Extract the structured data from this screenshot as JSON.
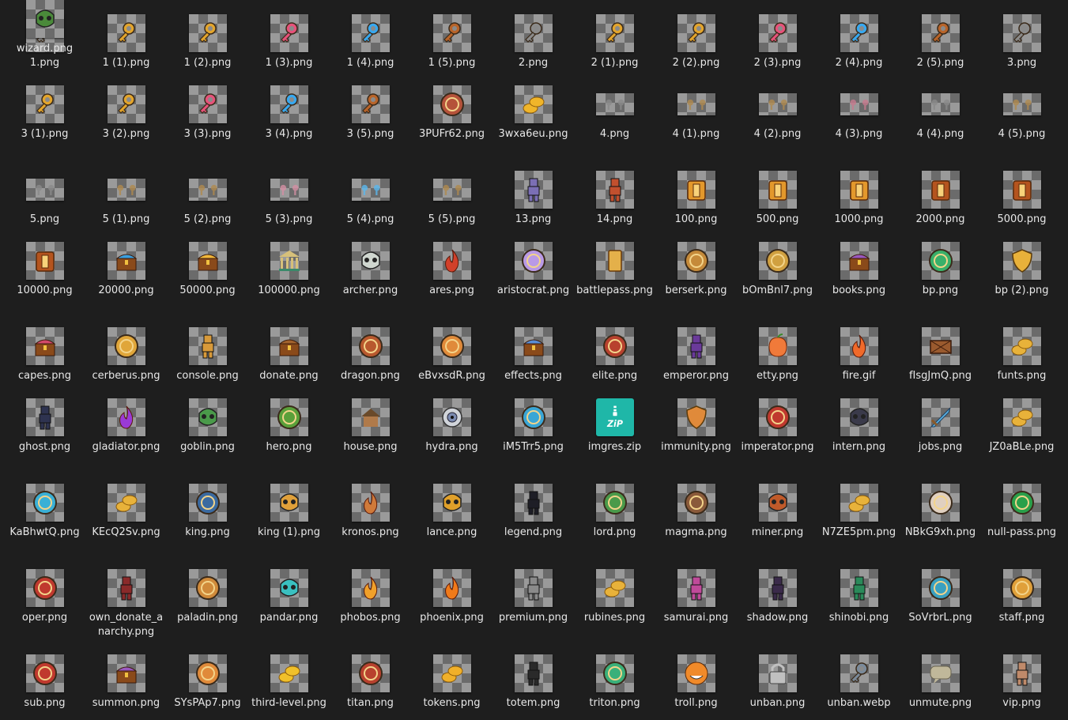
{
  "files": [
    {
      "name": "1.png",
      "icon": "key-gray-icon",
      "color": "#8b8b8b"
    },
    {
      "name": "1 (1).png",
      "icon": "key-gold-icon",
      "color": "#e3a52c"
    },
    {
      "name": "1 (2).png",
      "icon": "key-gold-icon",
      "color": "#e3a52c"
    },
    {
      "name": "1 (3).png",
      "icon": "key-pink-icon",
      "color": "#e6527a"
    },
    {
      "name": "1 (4).png",
      "icon": "key-blue-icon",
      "color": "#38a8ef"
    },
    {
      "name": "1 (5).png",
      "icon": "key-bronze-icon",
      "color": "#b8642a"
    },
    {
      "name": "2.png",
      "icon": "key-gray-icon",
      "color": "#8b8b8b"
    },
    {
      "name": "2 (1).png",
      "icon": "key-gold-icon",
      "color": "#e3a52c"
    },
    {
      "name": "2 (2).png",
      "icon": "key-gold-icon",
      "color": "#e3a52c"
    },
    {
      "name": "2 (3).png",
      "icon": "key-pink-icon",
      "color": "#e6527a"
    },
    {
      "name": "2 (4).png",
      "icon": "key-blue-icon",
      "color": "#38a8ef"
    },
    {
      "name": "2 (5).png",
      "icon": "key-bronze-icon",
      "color": "#b8642a"
    },
    {
      "name": "3.png",
      "icon": "key-gray-icon",
      "color": "#8b8b8b"
    },
    {
      "name": "3 (1).png",
      "icon": "key-gold-icon",
      "color": "#e3a52c"
    },
    {
      "name": "3 (2).png",
      "icon": "key-gold-icon",
      "color": "#e3a52c"
    },
    {
      "name": "3 (3).png",
      "icon": "key-pink-icon",
      "color": "#e6527a"
    },
    {
      "name": "3 (4).png",
      "icon": "key-blue-icon",
      "color": "#38a8ef"
    },
    {
      "name": "3 (5).png",
      "icon": "key-bronze-icon",
      "color": "#b8642a"
    },
    {
      "name": "3PUFr62.png",
      "icon": "avatar-image-icon",
      "color": "#b5523a"
    },
    {
      "name": "3wxa6eu.png",
      "icon": "gold-coins-icon",
      "color": "#f0b52a"
    },
    {
      "name": "4.png",
      "icon": "key-gray-icon",
      "color": "#8b8b8b",
      "wide": true
    },
    {
      "name": "4 (1).png",
      "icon": "key-gold-icon",
      "color": "#b08a4e",
      "wide": true
    },
    {
      "name": "4 (2).png",
      "icon": "key-gold-icon",
      "color": "#b08a4e",
      "wide": true
    },
    {
      "name": "4 (3).png",
      "icon": "key-pink-icon",
      "color": "#c77a8e",
      "wide": true
    },
    {
      "name": "4 (4).png",
      "icon": "key-blue-icon",
      "color": "#8b8b8b",
      "wide": true
    },
    {
      "name": "4 (5).png",
      "icon": "key-bronze-icon",
      "color": "#b08a4e",
      "wide": true
    },
    {
      "name": "5.png",
      "icon": "key-gray-icon",
      "color": "#8b8b8b",
      "wide": true
    },
    {
      "name": "5 (1).png",
      "icon": "key-gold-icon",
      "color": "#b08a4e",
      "wide": true
    },
    {
      "name": "5 (2).png",
      "icon": "key-gold-icon",
      "color": "#b08a4e",
      "wide": true
    },
    {
      "name": "5 (3).png",
      "icon": "key-pink-icon",
      "color": "#d590a4",
      "wide": true
    },
    {
      "name": "5 (4).png",
      "icon": "key-blue-icon",
      "color": "#5ab8ef",
      "wide": true
    },
    {
      "name": "5 (5).png",
      "icon": "key-bronze-icon",
      "color": "#b08a4e",
      "wide": true
    },
    {
      "name": "13.png",
      "icon": "character-image-icon",
      "color": "#7b6fb5"
    },
    {
      "name": "14.png",
      "icon": "character-image-icon",
      "color": "#c2502e"
    },
    {
      "name": "100.png",
      "icon": "case-icon",
      "color": "#e3982c"
    },
    {
      "name": "500.png",
      "icon": "case-icon",
      "color": "#e3982c"
    },
    {
      "name": "1000.png",
      "icon": "case-icon",
      "color": "#e3982c"
    },
    {
      "name": "2000.png",
      "icon": "case-icon",
      "color": "#b5541e"
    },
    {
      "name": "5000.png",
      "icon": "case-icon",
      "color": "#b5541e"
    },
    {
      "name": "10000.png",
      "icon": "case-icon",
      "color": "#b5541e"
    },
    {
      "name": "20000.png",
      "icon": "treasure-chest-icon",
      "color": "#3aa0e0"
    },
    {
      "name": "50000.png",
      "icon": "treasure-chest-icon",
      "color": "#f2b83a"
    },
    {
      "name": "100000.png",
      "icon": "temple-icon",
      "color": "#d6c07a"
    },
    {
      "name": "archer.png",
      "icon": "skull-icon",
      "color": "#cfd6cf"
    },
    {
      "name": "ares.png",
      "icon": "flame-emblem-icon",
      "color": "#d2402a"
    },
    {
      "name": "aristocrat.png",
      "icon": "winged-emblem-icon",
      "color": "#b99ae6"
    },
    {
      "name": "battlepass.png",
      "icon": "scroll-icon",
      "color": "#e4b04a"
    },
    {
      "name": "berserk.png",
      "icon": "avatar-badge-icon",
      "color": "#c58a3a"
    },
    {
      "name": "bOmBnl7.png",
      "icon": "avatar-badge-icon",
      "color": "#d0a040"
    },
    {
      "name": "books.png",
      "icon": "treasure-chest-icon",
      "color": "#9a58c0"
    },
    {
      "name": "bp.png",
      "icon": "battlepass-badge-icon",
      "color": "#39b06a"
    },
    {
      "name": "bp (2).png",
      "icon": "shield-icon",
      "color": "#e8b13a"
    },
    {
      "name": "capes.png",
      "icon": "treasure-chest-icon",
      "color": "#d24a6a"
    },
    {
      "name": "cerberus.png",
      "icon": "gold-emblem-icon",
      "color": "#e0a63a"
    },
    {
      "name": "console.png",
      "icon": "character-image-icon",
      "color": "#d89a3a"
    },
    {
      "name": "donate.png",
      "icon": "treasure-chest-icon",
      "color": "#a2632e"
    },
    {
      "name": "dragon.png",
      "icon": "avatar-badge-icon",
      "color": "#b8582e"
    },
    {
      "name": "eBvxsdR.png",
      "icon": "fox-emblem-icon",
      "color": "#e08a3a"
    },
    {
      "name": "effects.png",
      "icon": "treasure-chest-icon",
      "color": "#5a8ed6"
    },
    {
      "name": "elite.png",
      "icon": "avatar-badge-icon",
      "color": "#b8412e"
    },
    {
      "name": "emperor.png",
      "icon": "character-image-icon",
      "color": "#6a3a9a"
    },
    {
      "name": "etty.png",
      "icon": "fruit-icon",
      "color": "#f07a3a"
    },
    {
      "name": "fire.gif",
      "icon": "fire-icon",
      "color": "#f06a2a"
    },
    {
      "name": "fIsgJmQ.png",
      "icon": "crate-icon",
      "color": "#9a5a2e"
    },
    {
      "name": "funts.png",
      "icon": "gold-coins-icon",
      "color": "#e8b23a"
    },
    {
      "name": "ghost.png",
      "icon": "character-image-icon",
      "color": "#2e3350"
    },
    {
      "name": "gladiator.png",
      "icon": "purple-flame-icon",
      "color": "#9a3ad6"
    },
    {
      "name": "goblin.png",
      "icon": "goblin-mask-icon",
      "color": "#4a9a4a"
    },
    {
      "name": "hero.png",
      "icon": "avatar-badge-icon",
      "color": "#5aa03a"
    },
    {
      "name": "house.png",
      "icon": "house-icon",
      "color": "#b07a4a"
    },
    {
      "name": "hydra.png",
      "icon": "eye-orb-icon",
      "color": "#7a8ab0"
    },
    {
      "name": "iM5Trr5.png",
      "icon": "winged-emblem-icon",
      "color": "#3aa6d6"
    },
    {
      "name": "imgres.zip",
      "icon": "zip-archive-icon",
      "color": "#1fb7a8",
      "zip": true
    },
    {
      "name": "immunity.png",
      "icon": "shield-icon",
      "color": "#e08a3a"
    },
    {
      "name": "imperator.png",
      "icon": "avatar-badge-icon",
      "color": "#c0392e"
    },
    {
      "name": "intern.png",
      "icon": "dark-mask-icon",
      "color": "#3a3a4a"
    },
    {
      "name": "jobs.png",
      "icon": "sword-icon",
      "color": "#5ab0e0"
    },
    {
      "name": "JZ0aBLe.png",
      "icon": "gold-coins-icon",
      "color": "#e8b23a"
    },
    {
      "name": "KaBhwtQ.png",
      "icon": "winged-emblem-icon",
      "color": "#3ab0d6"
    },
    {
      "name": "KEcQ2Sv.png",
      "icon": "gold-coins-icon",
      "color": "#e8b23a"
    },
    {
      "name": "king.png",
      "icon": "avatar-badge-icon",
      "color": "#3a6aa0"
    },
    {
      "name": "king (1).png",
      "icon": "skull-crown-icon",
      "color": "#e0a03a"
    },
    {
      "name": "kronos.png",
      "icon": "flame-emblem-icon",
      "color": "#d07a3a"
    },
    {
      "name": "lance.png",
      "icon": "mask-icon",
      "color": "#e0a02a"
    },
    {
      "name": "legend.png",
      "icon": "character-image-icon",
      "color": "#1e1e26"
    },
    {
      "name": "lord.png",
      "icon": "avatar-badge-icon",
      "color": "#4a9a4a"
    },
    {
      "name": "magma.png",
      "icon": "avatar-badge-icon",
      "color": "#8a5a3a"
    },
    {
      "name": "miner.png",
      "icon": "mask-icon",
      "color": "#c05a2a"
    },
    {
      "name": "N7ZE5pm.png",
      "icon": "gold-coins-icon",
      "color": "#e8b23a"
    },
    {
      "name": "NBkG9xh.png",
      "icon": "winged-emblem-icon",
      "color": "#e0d0c0"
    },
    {
      "name": "null-pass.png",
      "icon": "badge-icon",
      "color": "#2aa04a"
    },
    {
      "name": "oper.png",
      "icon": "avatar-badge-icon",
      "color": "#c0392e"
    },
    {
      "name": "own_donate_anarchy.png",
      "icon": "character-image-icon",
      "color": "#8a2a2a"
    },
    {
      "name": "paladin.png",
      "icon": "avatar-badge-icon",
      "color": "#d08a3a"
    },
    {
      "name": "pandar.png",
      "icon": "skull-icon",
      "color": "#3ac0c0"
    },
    {
      "name": "phobos.png",
      "icon": "flame-emblem-icon",
      "color": "#f0a02a"
    },
    {
      "name": "phoenix.png",
      "icon": "flame-emblem-icon",
      "color": "#f07a1a"
    },
    {
      "name": "premium.png",
      "icon": "character-image-icon",
      "color": "#8a8a8a"
    },
    {
      "name": "rubines.png",
      "icon": "gold-coins-icon",
      "color": "#e8b23a"
    },
    {
      "name": "samurai.png",
      "icon": "character-image-icon",
      "color": "#c04a9a"
    },
    {
      "name": "shadow.png",
      "icon": "character-image-icon",
      "color": "#3a2a4a"
    },
    {
      "name": "shinobi.png",
      "icon": "character-image-icon",
      "color": "#2a8a5a"
    },
    {
      "name": "SoVrbrL.png",
      "icon": "winged-emblem-icon",
      "color": "#3aa0c0"
    },
    {
      "name": "staff.png",
      "icon": "gold-emblem-icon",
      "color": "#e0a03a"
    },
    {
      "name": "sub.png",
      "icon": "winged-emblem-icon",
      "color": "#c0392e"
    },
    {
      "name": "summon.png",
      "icon": "treasure-chest-icon",
      "color": "#9a58c0"
    },
    {
      "name": "SYsPAp7.png",
      "icon": "fox-emblem-icon",
      "color": "#e08a3a"
    },
    {
      "name": "third-level.png",
      "icon": "gold-coin-icon",
      "color": "#f0c02a"
    },
    {
      "name": "titan.png",
      "icon": "avatar-badge-icon",
      "color": "#b8412e"
    },
    {
      "name": "tokens.png",
      "icon": "gold-coins-icon",
      "color": "#f0b02a"
    },
    {
      "name": "totem.png",
      "icon": "character-image-icon",
      "color": "#2a2a2a"
    },
    {
      "name": "triton.png",
      "icon": "winged-emblem-icon",
      "color": "#3ab07a"
    },
    {
      "name": "troll.png",
      "icon": "troll-face-icon",
      "color": "#f08a2a"
    },
    {
      "name": "unban.png",
      "icon": "padlock-icon",
      "color": "#c0c0c0"
    },
    {
      "name": "unban.webp",
      "icon": "key-card-icon",
      "color": "#7a8a9a"
    },
    {
      "name": "unmute.png",
      "icon": "speech-bubble-icon",
      "color": "#c0b89a"
    },
    {
      "name": "vip.png",
      "icon": "character-image-icon",
      "color": "#c08a6a"
    },
    {
      "name": "wizard.png",
      "icon": "goblin-mask-icon",
      "color": "#4a8a3a"
    }
  ]
}
